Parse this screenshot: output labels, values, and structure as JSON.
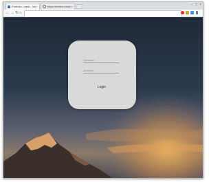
{
  "browser": {
    "tabs": [
      {
        "title": "Portfolio | vault - Meteo.com",
        "close": "×"
      },
      {
        "title": "https://meteo.example.com",
        "close": "×"
      }
    ],
    "window_controls": [
      "–",
      "□",
      "×"
    ],
    "nav_icons": [
      "back-arrow-icon",
      "forward-arrow-icon",
      "reload-icon",
      "home-icon"
    ],
    "nav_glyphs": {
      "back": "←",
      "forward": "→",
      "reload": "↻",
      "home": "⌂"
    },
    "address": "",
    "extensions": [
      {
        "name": "stop-extension-icon",
        "color": "#d93025"
      },
      {
        "name": "puzzle-extension-icon",
        "color": "#c8a43a"
      },
      {
        "name": "grid-extension-icon",
        "color": "#4a8fd9"
      },
      {
        "name": "menu-extension-icon",
        "color": "#7a7a7a"
      }
    ]
  },
  "login_form": {
    "username_placeholder": "Username",
    "password_placeholder": "password",
    "login_label": "Login"
  },
  "colors": {
    "sky_top": "#1f2d3d",
    "sky_bottom": "#6c6a78",
    "sunset": "#d39a4e",
    "card": "#d9d9d9"
  }
}
